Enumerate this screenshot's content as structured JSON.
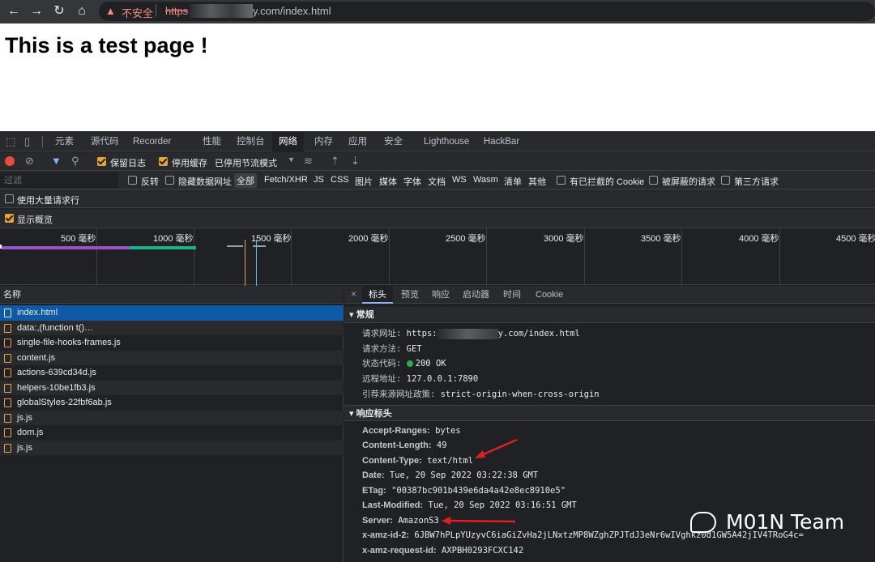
{
  "browser": {
    "not_secure": "不安全",
    "url_scheme": "https",
    "url_rest": "y.com/index.html",
    "icons": [
      "back-icon",
      "forward-icon",
      "reload-icon",
      "home-icon",
      "warning-icon"
    ]
  },
  "page": {
    "heading": "This is a test page !"
  },
  "devtools": {
    "tabs": [
      "元素",
      "源代码",
      "Recorder",
      "性能",
      "控制台",
      "网络",
      "内存",
      "应用",
      "安全",
      "Lighthouse",
      "HackBar"
    ],
    "active_tab": "网络",
    "toolbar": {
      "preserve_log": "保留日志",
      "disable_cache": "停用缓存",
      "throttle": "已停用节流模式"
    },
    "filter": {
      "placeholder": "过滤",
      "invert": "反转",
      "hide_data_urls": "隐藏数据网址",
      "types": [
        "全部",
        "Fetch/XHR",
        "JS",
        "CSS",
        "图片",
        "媒体",
        "字体",
        "文档",
        "WS",
        "Wasm",
        "清单",
        "其他"
      ],
      "blocked_cookies": "有已拦截的 Cookie",
      "blocked_requests": "被屏蔽的请求",
      "third_party": "第三方请求"
    },
    "options": {
      "large_rows": "使用大量请求行",
      "show_overview": "显示概览"
    },
    "overview_ticks": [
      "500 毫秒",
      "1000 毫秒",
      "1500 毫秒",
      "2000 毫秒",
      "2500 毫秒",
      "3000 毫秒",
      "3500 毫秒",
      "4000 毫秒",
      "4500 毫秒"
    ],
    "requests_header": "名称",
    "requests": [
      "index.html",
      "data:,(function t()…",
      "single-file-hooks-frames.js",
      "content.js",
      "actions-639cd34d.js",
      "helpers-10be1fb3.js",
      "globalStyles-22fbf6ab.js",
      "js.js",
      "dom.js",
      "js.js"
    ],
    "detail_tabs": [
      "标头",
      "预览",
      "响应",
      "启动器",
      "时间",
      "Cookie"
    ],
    "general": {
      "title": "常规",
      "url_label": "请求网址:",
      "url_scheme": "https:",
      "url_rest": "y.com/index.html",
      "method_label": "请求方法:",
      "method": "GET",
      "status_label": "状态代码:",
      "status": "200 OK",
      "remote_label": "远程地址:",
      "remote": "127.0.0.1:7890",
      "referrer_label": "引荐来源网址政策:",
      "referrer": "strict-origin-when-cross-origin"
    },
    "response_headers": {
      "title": "响应标头",
      "rows": [
        {
          "k": "Accept-Ranges:",
          "v": "bytes"
        },
        {
          "k": "Content-Length:",
          "v": "49"
        },
        {
          "k": "Content-Type:",
          "v": "text/html"
        },
        {
          "k": "Date:",
          "v": "Tue, 20 Sep 2022 03:22:38 GMT"
        },
        {
          "k": "ETag:",
          "v": "\"00387bc901b439e6da4a42e8ec8910e5\""
        },
        {
          "k": "Last-Modified:",
          "v": "Tue, 20 Sep 2022 03:16:51 GMT"
        },
        {
          "k": "Server:",
          "v": "AmazonS3"
        },
        {
          "k": "x-amz-id-2:",
          "v": "6JBW7hPLpYUzyvC6iaGiZvHa2jLNxtzMP8WZghZPJTdJ3eNr6wIVghkz0d1GW5A42jIV4TRoG4c="
        },
        {
          "k": "x-amz-request-id:",
          "v": "AXPBH0293FCXC142"
        }
      ]
    }
  },
  "watermark": "M01N Team"
}
